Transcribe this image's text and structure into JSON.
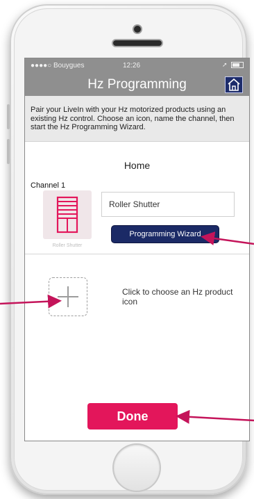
{
  "status_bar": {
    "carrier": "●●●●○ Bouygues",
    "time": "12:26"
  },
  "header": {
    "title": "Hz Programming",
    "home_icon": "home-icon"
  },
  "intro": {
    "text": "Pair your LiveIn with your Hz motorized products using an existing Hz control. Choose an icon, name the channel, then start the Hz Programming Wizard."
  },
  "main": {
    "section_title": "Home",
    "channel_label": "Channel 1",
    "channel_icon": "roller-shutter-icon",
    "icon_caption": "Roller Shutter",
    "name_field_value": "Roller Shutter",
    "wizard_button_label": "Programming Wizard",
    "add_product_text": "Click to choose an Hz product icon"
  },
  "footer": {
    "done_label": "Done"
  },
  "colors": {
    "nav_gray": "#8f8f8f",
    "navy": "#1b2a66",
    "accent_pink": "#e3165b",
    "arrow": "#c4145a"
  }
}
